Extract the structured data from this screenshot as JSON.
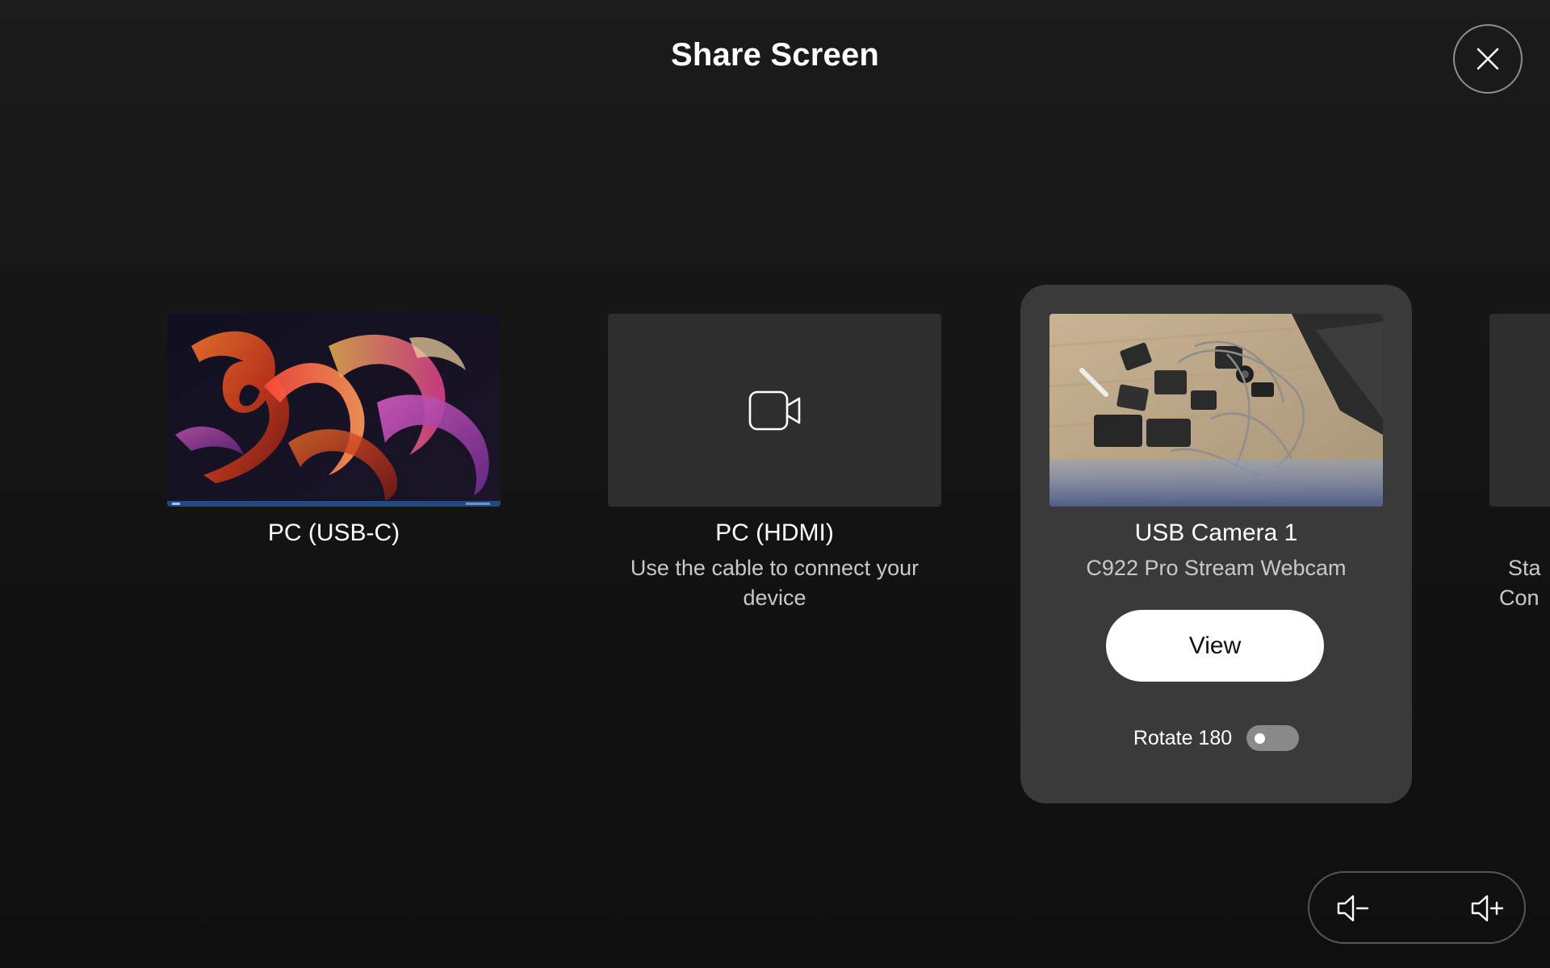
{
  "header": {
    "title": "Share Screen",
    "close_icon": "close-icon"
  },
  "sources": [
    {
      "label": "PC (USB-C)",
      "sublabel": "",
      "thumbnail": "desktop-wallpaper-thumbnail"
    },
    {
      "label": "PC (HDMI)",
      "sublabel": "Use the cable to connect your device",
      "thumbnail_icon": "video-camera-icon"
    },
    {
      "label": "USB Camera 1",
      "sublabel": "C922 Pro Stream Webcam",
      "thumbnail": "camera-preview-thumbnail",
      "selected": true,
      "view_label": "View",
      "rotate_label": "Rotate 180",
      "rotate_enabled": false
    },
    {
      "label": "",
      "sublabel_line1": "Sta",
      "sublabel_line2": "Con"
    }
  ],
  "volume": {
    "down_icon": "volume-down-icon",
    "up_icon": "volume-up-icon"
  },
  "colors": {
    "background": "#141414",
    "selected_card": "#3a3a3a",
    "placeholder": "#2e2e2e",
    "button": "#ffffff"
  }
}
